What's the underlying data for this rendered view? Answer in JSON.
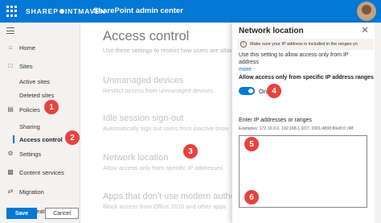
{
  "suite_bar": {
    "brand_left": "SHAREP",
    "brand_right": "INTMAVEN",
    "title": "SharePoint admin center",
    "waffle_icon": "waffle-icon",
    "accent_color": "#0078d4"
  },
  "nav": {
    "items": [
      {
        "label": "Home",
        "icon": "home-icon"
      },
      {
        "label": "Sites",
        "icon": "sites-icon"
      },
      {
        "label": "Active sites",
        "icon": ""
      },
      {
        "label": "Deleted sites",
        "icon": ""
      },
      {
        "label": "Policies",
        "icon": "policies-icon"
      },
      {
        "label": "Sharing",
        "icon": ""
      },
      {
        "label": "Access control",
        "icon": ""
      },
      {
        "label": "Settings",
        "icon": "settings-icon"
      },
      {
        "label": "Content services",
        "icon": "content-services-icon"
      },
      {
        "label": "Migration",
        "icon": "migration-icon"
      },
      {
        "label": "More features",
        "icon": "more-features-icon"
      }
    ],
    "active_item": "Access control"
  },
  "background": {
    "title": "Access control",
    "description": "Use these settings to restrict how users are allowe",
    "sections": [
      {
        "title": "Unmanaged devices",
        "description": "Restrict access from unmanaged devices."
      },
      {
        "title": "Idle session sign-out",
        "description": "Automatically sign out users from inactive brow"
      },
      {
        "title": "Network location",
        "description": "Allow access only from specific IP addresses."
      },
      {
        "title": "Apps that don't use modern auther",
        "description": "Block access from Office 2010 and other apps"
      }
    ]
  },
  "panel": {
    "title": "Network location",
    "message": "Make sure your IP address is included in the ranges yo",
    "description": "Use this setting to allow access only from IP address",
    "more_link": "more",
    "toggle_label": "Allow access only from specific IP address ranges",
    "toggle_state": "On",
    "toggle_on": true,
    "ip_label": "Enter IP addresses or ranges",
    "ip_examples": "Examples: 172.16.0.0, 192.168.1.0/27, 2001:4898:80e8:0::/48",
    "ip_value": "",
    "save_label": "Save",
    "cancel_label": "Cancel"
  },
  "callouts": [
    "1",
    "2",
    "3",
    "4",
    "5",
    "6"
  ]
}
